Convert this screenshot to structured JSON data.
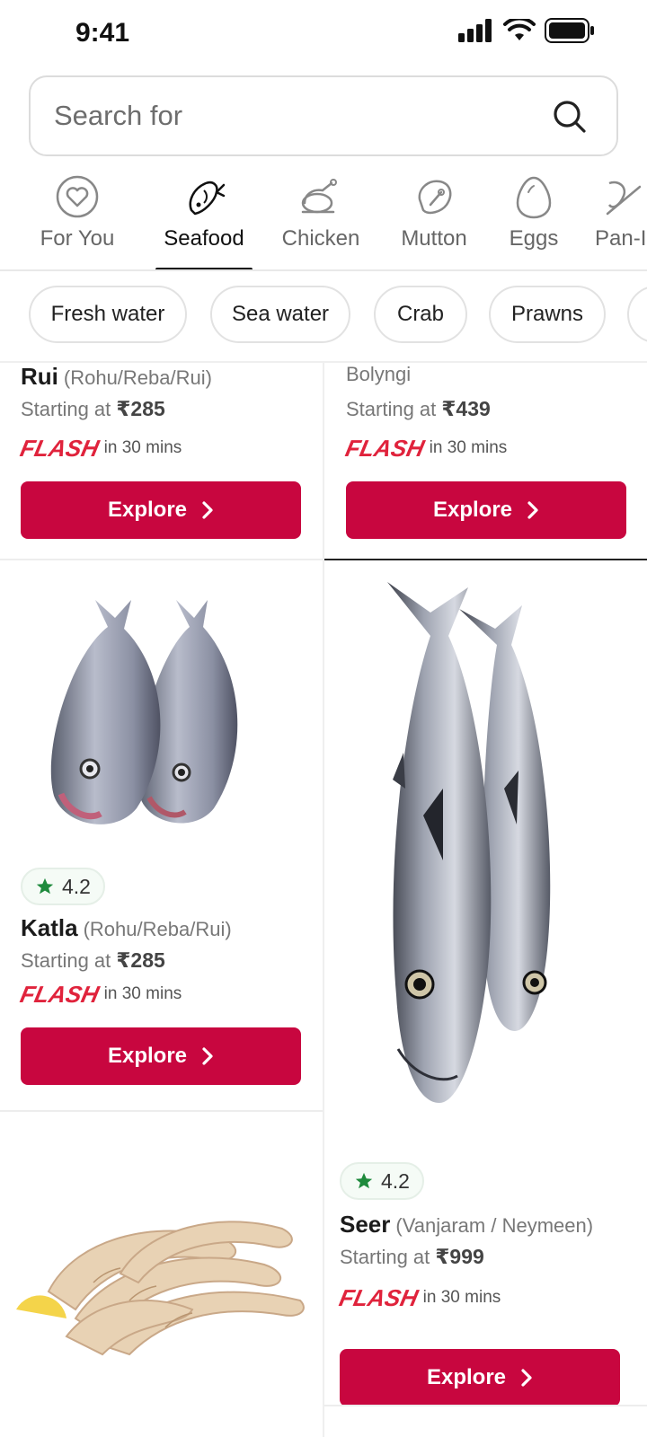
{
  "status_bar": {
    "time": "9:41"
  },
  "search": {
    "placeholder": "Search for"
  },
  "categories": [
    {
      "label": "For You",
      "icon": "heart-icon"
    },
    {
      "label": "Seafood",
      "icon": "fish-icon",
      "active": true
    },
    {
      "label": "Chicken",
      "icon": "chicken-icon"
    },
    {
      "label": "Mutton",
      "icon": "mutton-icon"
    },
    {
      "label": "Eggs",
      "icon": "egg-icon"
    },
    {
      "label": "Pan-I",
      "icon": "pan-icon"
    }
  ],
  "subcategories": [
    "Fresh water",
    "Sea water",
    "Crab",
    "Prawns"
  ],
  "products": [
    {
      "name": "Rui",
      "alt_names": "(Rohu/Reba/Rui)",
      "starting_label": "Starting at",
      "price": "₹285",
      "delivery": "in 30 mins",
      "button": "Explore"
    },
    {
      "name": "",
      "alt_names": "Bolyngi",
      "starting_label": "Starting at",
      "price": "₹439",
      "delivery": "in 30 mins",
      "button": "Explore"
    },
    {
      "name": "Katla",
      "alt_names": "(Rohu/Reba/Rui)",
      "rating": "4.2",
      "starting_label": "Starting at",
      "price": "₹285",
      "delivery": "in 30 mins",
      "button": "Explore"
    },
    {
      "name": "Seer",
      "alt_names": "(Vanjaram / Neymeen)",
      "rating": "4.2",
      "starting_label": "Starting at",
      "price": "₹999",
      "delivery": "in 30 mins",
      "button": "Explore"
    }
  ],
  "flash_brand": "FLASH",
  "colors": {
    "accent": "#c8063f",
    "flash": "#e0233c",
    "star": "#1e8a3c"
  }
}
